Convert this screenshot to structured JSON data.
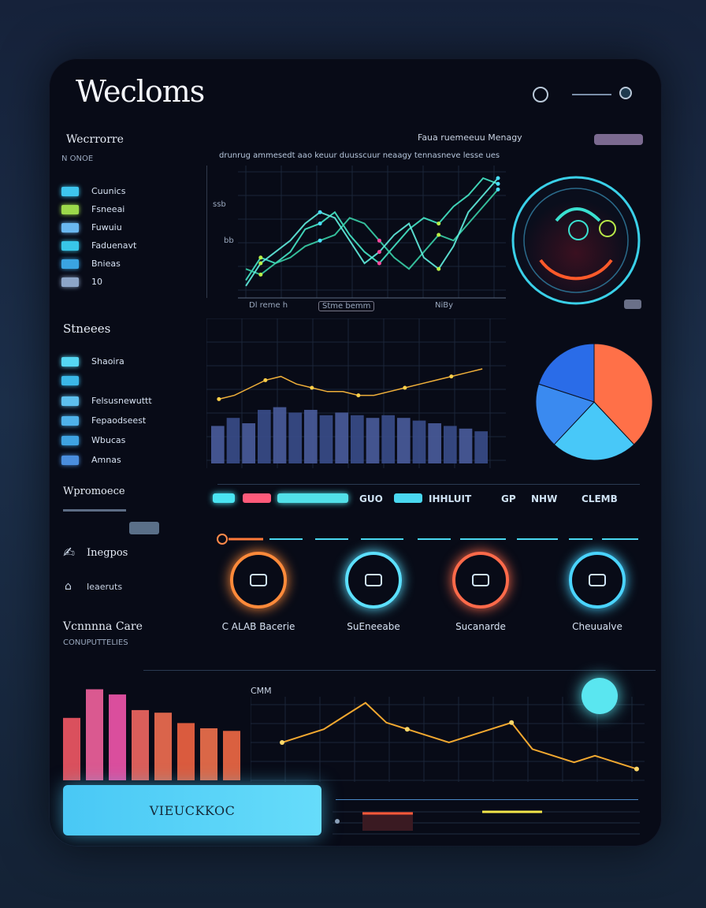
{
  "header": {
    "title": "Wecloms",
    "icons": [
      "circle-icon",
      "dot-icon"
    ]
  },
  "sidebar": {
    "heading": "Wecrrorre",
    "subheading": "N ONOE",
    "items": [
      {
        "label": "Cuunics",
        "color": "#3ec6ef"
      },
      {
        "label": "Fsneeai",
        "color": "#9cd94b"
      },
      {
        "label": "Fuwuiu",
        "color": "#6ab8f0"
      },
      {
        "label": "Faduenavt",
        "color": "#38c6e8"
      },
      {
        "label": "Bnieas",
        "color": "#3aa4e2"
      },
      {
        "label": "10",
        "color": "#8da6c8"
      }
    ],
    "section2": "Stneees",
    "items2": [
      {
        "label": "Shaoira",
        "color": "#56d7f3"
      },
      {
        "label": "",
        "color": "#3bb8e8"
      },
      {
        "label": "Felsusnewuttt",
        "color": "#5ec0ee"
      },
      {
        "label": "Fepaodseest",
        "color": "#4fb2ea"
      },
      {
        "label": "Wbucas",
        "color": "#3fa3e2"
      },
      {
        "label": "Amnas",
        "color": "#4a8ede"
      }
    ],
    "section3": "Wpromoece",
    "row3": "",
    "section4": "Inegpos",
    "section5": "Ieaeruts",
    "section6": "Vcnnnna Care",
    "section6_sub": "CONUPUTTELIES"
  },
  "top_chart": {
    "header": "Faua ruemeeuu Menagy",
    "legend": "drunrug ammesedt aao keuur duusscuur neaagy tennasneve lesse ues",
    "y_ticks": [
      "ssb",
      "bb"
    ],
    "x_labels": [
      "Dl reme h",
      "Stme bemm",
      "NiBy"
    ],
    "button_label": ""
  },
  "chart_data": [
    {
      "type": "line",
      "title": "",
      "series": [
        {
          "values": [
            4,
            12,
            10,
            14,
            22,
            24,
            28,
            20,
            14,
            10,
            16,
            22,
            26,
            24,
            30,
            34,
            40,
            38
          ]
        },
        {
          "values": [
            8,
            6,
            10,
            12,
            16,
            18,
            20,
            26,
            24,
            18,
            12,
            8,
            14,
            20,
            18,
            24,
            30,
            36
          ]
        },
        {
          "values": [
            2,
            10,
            14,
            18,
            24,
            28,
            26,
            18,
            10,
            14,
            20,
            24,
            12,
            8,
            16,
            28,
            34,
            40
          ]
        }
      ]
    },
    {
      "type": "bar",
      "title": "",
      "values": [
        28,
        34,
        30,
        40,
        42,
        38,
        40,
        36,
        38,
        36,
        34,
        36,
        34,
        32,
        30,
        28,
        26,
        24
      ],
      "line_values": [
        34,
        36,
        40,
        44,
        46,
        42,
        40,
        38,
        38,
        36,
        36,
        38,
        40,
        42,
        44,
        46,
        48,
        50
      ]
    },
    {
      "type": "pie",
      "values": [
        38,
        24,
        18,
        20
      ],
      "colors": [
        "#ff7048",
        "#48c8f8",
        "#3a8af0",
        "#2a6ce8"
      ]
    },
    {
      "type": "bar",
      "values": [
        48,
        70,
        66,
        54,
        52,
        44,
        40,
        38
      ],
      "colors": [
        "#ff5d6a",
        "#ff67a6",
        "#ff5bb5",
        "#ff6d66",
        "#ff7455",
        "#ff6a45",
        "#ff7850",
        "#ff7048"
      ]
    },
    {
      "type": "line",
      "values": [
        10,
        12,
        14,
        18,
        22,
        16,
        14,
        12,
        10,
        12,
        14,
        16,
        8,
        6,
        4,
        6,
        4,
        2
      ],
      "title": "CMM"
    }
  ],
  "tabs": {
    "labels": [
      "GUO",
      "IHHLUIT",
      "GP",
      "NHW",
      "CLEMB"
    ]
  },
  "rings": [
    {
      "label": "C ALAB Bacerie",
      "color": "#ff8a3a"
    },
    {
      "label": "SuEneeabe",
      "color": "#5ce0ff"
    },
    {
      "label": "Sucanarde",
      "color": "#ff6a4a"
    },
    {
      "label": "Cheuualve",
      "color": "#4ad4ff"
    }
  ],
  "cta": {
    "label": "VIEUCKKOC"
  },
  "bottom_right": {
    "title": "CMM"
  }
}
